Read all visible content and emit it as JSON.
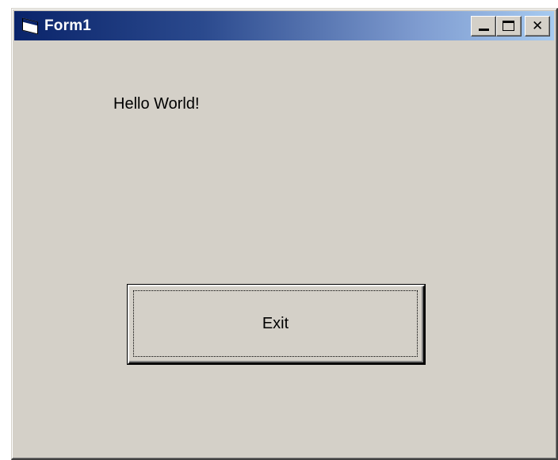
{
  "window": {
    "title": "Form1",
    "icon": "form-icon",
    "controls": {
      "minimize": "minimize-icon",
      "maximize": "maximize-icon",
      "close": "close-icon",
      "close_glyph": "✕"
    }
  },
  "form": {
    "label_text": "Hello World!",
    "exit_button_label": "Exit"
  },
  "colors": {
    "face": "#d4d0c8",
    "title_start": "#0a246a",
    "title_end": "#a6caf0"
  }
}
